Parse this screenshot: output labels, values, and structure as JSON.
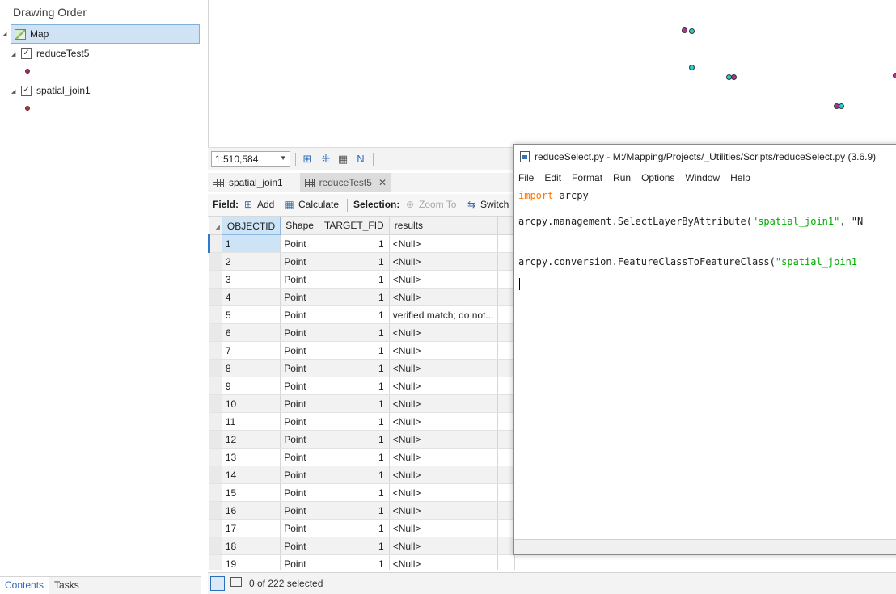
{
  "contents": {
    "title": "Drawing Order",
    "map_label": "Map",
    "layers": [
      {
        "name": "reduceTest5",
        "checked": true,
        "symbol_color": "#9c2d6c"
      },
      {
        "name": "spatial_join1",
        "checked": true,
        "symbol_color": "#b3363c"
      }
    ],
    "tabs": [
      "Contents",
      "Tasks"
    ]
  },
  "map_footer": {
    "scale": "1:510,584"
  },
  "table_view": {
    "tabs": [
      {
        "label": "spatial_join1",
        "active": false
      },
      {
        "label": "reduceTest5",
        "active": true,
        "closable": true
      }
    ],
    "toolbar": {
      "field_label": "Field:",
      "add_label": "Add",
      "calculate_label": "Calculate",
      "selection_label": "Selection:",
      "zoom_to_label": "Zoom To",
      "switch_label": "Switch"
    },
    "columns": [
      "OBJECTID",
      "Shape",
      "TARGET_FID",
      "results"
    ],
    "rows": [
      [
        "1",
        "Point",
        "1",
        "<Null>"
      ],
      [
        "2",
        "Point",
        "1",
        "<Null>"
      ],
      [
        "3",
        "Point",
        "1",
        "<Null>"
      ],
      [
        "4",
        "Point",
        "1",
        "<Null>"
      ],
      [
        "5",
        "Point",
        "1",
        "verified match; do not..."
      ],
      [
        "6",
        "Point",
        "1",
        "<Null>"
      ],
      [
        "7",
        "Point",
        "1",
        "<Null>"
      ],
      [
        "8",
        "Point",
        "1",
        "<Null>"
      ],
      [
        "9",
        "Point",
        "1",
        "<Null>"
      ],
      [
        "10",
        "Point",
        "1",
        "<Null>"
      ],
      [
        "11",
        "Point",
        "1",
        "<Null>"
      ],
      [
        "12",
        "Point",
        "1",
        "<Null>"
      ],
      [
        "13",
        "Point",
        "1",
        "<Null>"
      ],
      [
        "14",
        "Point",
        "1",
        "<Null>"
      ],
      [
        "15",
        "Point",
        "1",
        "<Null>"
      ],
      [
        "16",
        "Point",
        "1",
        "<Null>"
      ],
      [
        "17",
        "Point",
        "1",
        "<Null>"
      ],
      [
        "18",
        "Point",
        "1",
        "<Null>"
      ],
      [
        "19",
        "Point",
        "1",
        "<Null>"
      ]
    ],
    "status": "0 of 222 selected"
  },
  "editor": {
    "title": "reduceSelect.py - M:/Mapping/Projects/_Utilities/Scripts/reduceSelect.py (3.6.9)",
    "menu": [
      "File",
      "Edit",
      "Format",
      "Run",
      "Options",
      "Window",
      "Help"
    ],
    "code": {
      "l1_kw": "import",
      "l1_rest": " arcpy",
      "l2_pre": "arcpy.management.SelectLayerByAttribute(",
      "l2_str": "\"spatial_join1\"",
      "l2_post": ", \"N",
      "l3_pre": "arcpy.conversion.FeatureClassToFeatureClass(",
      "l3_str": "\"spatial_join1'"
    }
  },
  "colors": {
    "selection_blue": "#cde4f7",
    "point_teal": "#1fd1d1",
    "point_purple": "#b0338a",
    "keyword_orange": "#ff7700",
    "string_green": "#00aa00"
  }
}
